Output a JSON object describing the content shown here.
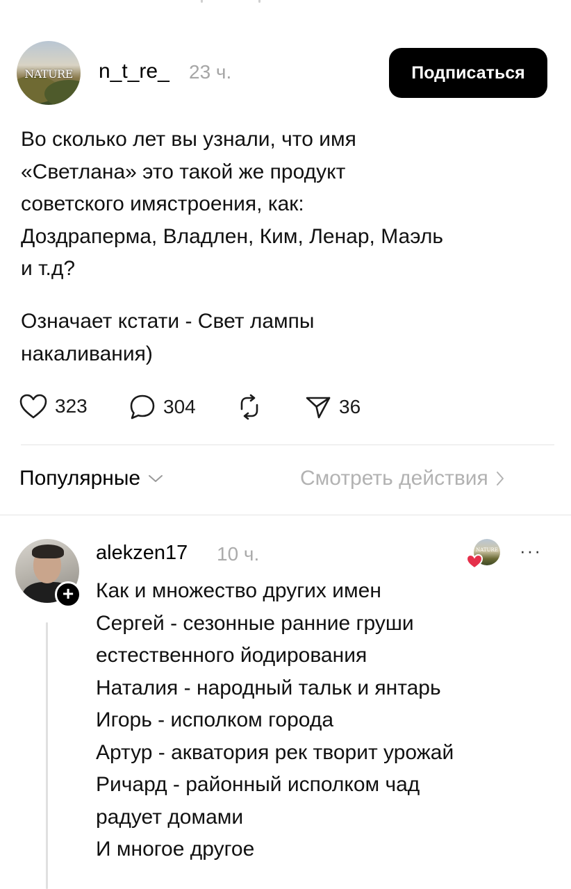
{
  "post": {
    "author": {
      "username": "n_t_re_",
      "time_ago": "23 ч.",
      "avatar_logo_text": "NATURE",
      "avatar_icon": "nature-landscape-avatar"
    },
    "follow_button_label": "Подписаться",
    "text_lines": [
      "Во сколько лет вы узнали, что имя",
      "«Светлана» это такой же продукт",
      "советского имястроения, как:",
      "Доздраперма, Владлен, Ким, Ленар, Маэль",
      "и т.д?"
    ],
    "text_lines_2": [
      "Означает кстати - Свет лампы",
      "накаливания)"
    ],
    "actions": {
      "likes": "323",
      "comments": "304",
      "reposts": "",
      "shares": "36",
      "icons": [
        "heart-icon",
        "comment-bubble-icon",
        "repost-icon",
        "send-icon"
      ]
    }
  },
  "replies_bar": {
    "sort_label": "Популярные",
    "activity_link_label": "Смотреть действия"
  },
  "comment": {
    "username": "alekzen17",
    "time_ago": "10 ч.",
    "more_label": "···",
    "text_lines": [
      "Как и множество других имен",
      "Сергей - сезонные ранние груши",
      "естественного йодирования",
      "Наталия - народный тальк и янтарь",
      "Игорь - исполком города",
      "Артур - акватория рек творит урожай",
      "Ричард - районный исполком чад",
      "радует домами",
      "И многое другое"
    ],
    "liked_by_author_logo_text": "NATURE"
  },
  "colors": {
    "text": "#111111",
    "muted": "#a6a6a6",
    "link_muted": "#b2b2b2",
    "divider": "#e4e4e4",
    "button_bg": "#000000",
    "heart_red": "#e5304a"
  }
}
